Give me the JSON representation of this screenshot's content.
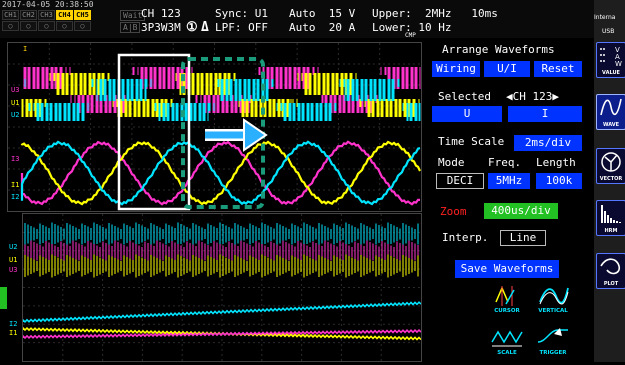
{
  "header": {
    "datetime": "2017-04-05 20:38:50",
    "channels_row1": [
      "CH1",
      "CH2",
      "CH3",
      "CH4",
      "CH5"
    ],
    "channels_row2": [
      "○",
      "○",
      "○",
      "○",
      "○"
    ],
    "wait_label": "Wait",
    "ab_label": "A|B",
    "channel_name": "CH 123",
    "wiring": "3P3W3M",
    "marker_1": "①",
    "delta": "Δ",
    "sync": "Sync: U1",
    "lpf": "LPF: OFF",
    "range_u": "Auto  15 V",
    "range_i": "Auto  20 A",
    "upper": "Upper:  2MHz   10ms",
    "lower": "Lower: 10 Hz",
    "cmp": "CMP",
    "internal": "Interna",
    "usb": "USB"
  },
  "upper_wave_labels": {
    "top": "U3",
    "mid1": "U1",
    "mid2": "U2",
    "i3": "I3",
    "i1": "I1",
    "i2": "I2",
    "cursor": "I"
  },
  "lower_wave_labels": {
    "u2": "U2",
    "u1": "U1",
    "u3": "U3",
    "i2": "I2",
    "i1": "I1"
  },
  "panel": {
    "arrange_title": "Arrange Waveforms",
    "btn_wiring": "Wiring",
    "btn_ui": "U/I",
    "btn_reset": "Reset",
    "selected_label": "Selected",
    "selected_channel": "◀CH 123▶",
    "btn_u": "U",
    "btn_i": "I",
    "timescale_label": "Time Scale",
    "timescale_value": "2ms/div",
    "mode_label": "Mode",
    "freq_label": "Freq.",
    "length_label": "Length",
    "mode_value": "DECI",
    "freq_value": "5MHz",
    "length_value": "100k",
    "zoom_label": "Zoom",
    "zoom_value": "400us/div",
    "interp_label": "Interp.",
    "interp_value": "Line",
    "save_label": "Save Waveforms",
    "tools": [
      "CURSOR",
      "VERTICAL",
      "SCALE",
      "TRIGGER"
    ]
  },
  "sidebar": [
    "VALUE",
    "WAVE",
    "VECTOR",
    "HRM",
    "PLOT"
  ],
  "colors": {
    "u1": "#ffff00",
    "u2": "#ff33cc",
    "u3": "#00e5ff",
    "btn": "#0033ff",
    "zoom": "#ff2020",
    "zoom_btn": "#22c022",
    "highlight": "#1a9c7c"
  }
}
